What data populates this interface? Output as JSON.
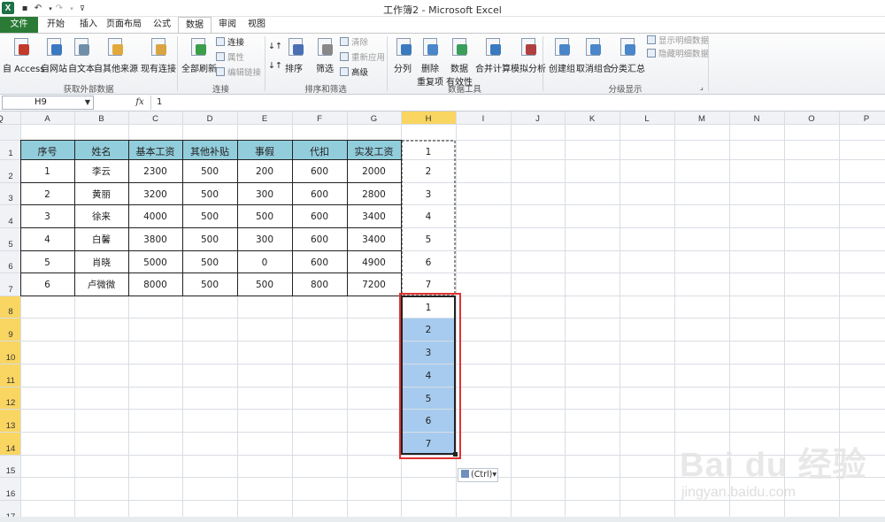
{
  "window": {
    "title": "工作簿2 - Microsoft Excel"
  },
  "tabs": [
    {
      "label": "文件",
      "file": true
    },
    {
      "label": "开始"
    },
    {
      "label": "插入"
    },
    {
      "label": "页面布局"
    },
    {
      "label": "公式"
    },
    {
      "label": "数据",
      "active": true
    },
    {
      "label": "审阅"
    },
    {
      "label": "视图"
    }
  ],
  "ribbon": {
    "groups": [
      {
        "label": "获取外部数据"
      },
      {
        "label": "连接"
      },
      {
        "label": "排序和筛选"
      },
      {
        "label": "数据工具"
      },
      {
        "label": "分级显示"
      }
    ],
    "large_buttons": [
      {
        "label": "自 Access",
        "icon": "access-icon"
      },
      {
        "label": "自网站",
        "icon": "web-icon"
      },
      {
        "label": "自文本",
        "icon": "text-file-icon"
      },
      {
        "label": "自其他来源",
        "icon": "other-source-icon"
      },
      {
        "label": "现有连接",
        "icon": "existing-connection-icon"
      },
      {
        "label": "全部刷新",
        "icon": "refresh-icon"
      },
      {
        "label": "排序",
        "icon": "sort-icon"
      },
      {
        "label": "筛选",
        "icon": "filter-icon"
      },
      {
        "label": "分列",
        "icon": "text-to-columns-icon"
      },
      {
        "label": "删除",
        "label2": "重复项",
        "icon": "remove-duplicates-icon"
      },
      {
        "label": "数据",
        "label2": "有效性",
        "icon": "data-validation-icon"
      },
      {
        "label": "合并计算",
        "icon": "consolidate-icon"
      },
      {
        "label": "模拟分析",
        "icon": "what-if-icon"
      },
      {
        "label": "创建组",
        "icon": "group-icon"
      },
      {
        "label": "取消组合",
        "icon": "ungroup-icon"
      },
      {
        "label": "分类汇总",
        "icon": "subtotal-icon"
      }
    ],
    "small_buttons": [
      {
        "label": "连接",
        "dim": false
      },
      {
        "label": "属性",
        "dim": true
      },
      {
        "label": "编辑链接",
        "dim": true
      },
      {
        "label": "清除",
        "dim": true
      },
      {
        "label": "重新应用",
        "dim": true
      },
      {
        "label": "高级",
        "dim": false
      },
      {
        "label": "显示明细数据",
        "dim": true
      },
      {
        "label": "隐藏明细数据",
        "dim": true
      }
    ]
  },
  "formula_bar": {
    "name_box": "H9",
    "fx": "fx",
    "value": "1"
  },
  "columns": [
    "A",
    "B",
    "C",
    "D",
    "E",
    "F",
    "G",
    "H",
    "I",
    "J",
    "K",
    "L",
    "M",
    "N",
    "O",
    "P",
    "Q"
  ],
  "rows": [
    "1",
    "2",
    "3",
    "4",
    "5",
    "6",
    "7",
    "8",
    "9",
    "10",
    "11",
    "12",
    "13",
    "14",
    "15",
    "16",
    "17"
  ],
  "table": {
    "headers": [
      "序号",
      "姓名",
      "基本工资",
      "其他补贴",
      "事假",
      "代扣",
      "实发工资"
    ],
    "rows": [
      [
        "1",
        "李云",
        "2300",
        "500",
        "200",
        "600",
        "2000"
      ],
      [
        "2",
        "黄丽",
        "3200",
        "500",
        "300",
        "600",
        "2800"
      ],
      [
        "3",
        "徐来",
        "4000",
        "500",
        "500",
        "600",
        "3400"
      ],
      [
        "4",
        "白馨",
        "3800",
        "500",
        "300",
        "600",
        "3400"
      ],
      [
        "5",
        "肖晓",
        "5000",
        "500",
        "0",
        "600",
        "4900"
      ],
      [
        "6",
        "卢微微",
        "8000",
        "500",
        "500",
        "800",
        "7200"
      ]
    ]
  },
  "column_h": {
    "copied_values": [
      "1",
      "2",
      "3",
      "4",
      "5",
      "6",
      "7"
    ],
    "pasted_values": [
      "1",
      "2",
      "3",
      "4",
      "5",
      "6",
      "7"
    ]
  },
  "paste_options": {
    "label": "(Ctrl)▾",
    "icon": "paste-options-icon"
  },
  "watermark": {
    "main": "Bai du 经验",
    "sub": "jingyan.baidu.com"
  },
  "colors": {
    "header_fill": "#92cddc",
    "selection_fill": "#a6cbef",
    "active_header": "#f9d561",
    "ribbon_green": "#2b7b37"
  }
}
